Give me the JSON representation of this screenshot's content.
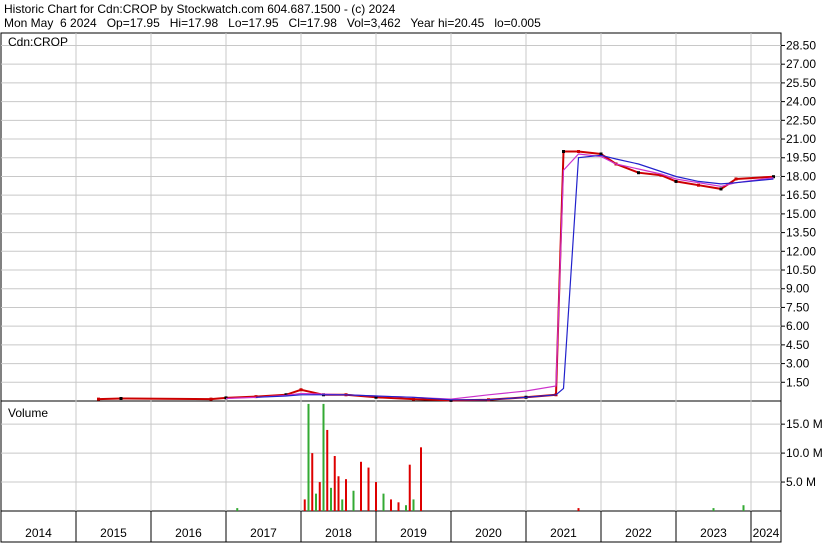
{
  "header": {
    "line1": "Historic Chart for Cdn:CROP by Stockwatch.com 604.687.1500 - (c) 2024",
    "line2": "Mon May  6 2024   Op=17.95   Hi=17.98   Lo=17.95   Cl=17.98   Vol=3,462   Year hi=20.45   lo=0.005"
  },
  "colors": {
    "price_up": "#000000",
    "price_down": "#cc0000",
    "ma_short": "#cc33cc",
    "ma_long": "#2222cc",
    "vol_up": "#33aa33",
    "vol_down": "#dd0000",
    "grid": "#c8c8c8"
  },
  "chart_data": [
    {
      "type": "line",
      "panel": "price",
      "label": "Cdn:CROP",
      "y_ticks": [
        "1.50",
        "3.00",
        "4.50",
        "6.00",
        "7.50",
        "9.00",
        "10.50",
        "12.00",
        "13.50",
        "15.00",
        "16.50",
        "18.00",
        "19.50",
        "21.00",
        "22.50",
        "24.00",
        "25.50",
        "27.00",
        "28.50"
      ],
      "ylim": [
        0,
        29.5
      ],
      "x_labels": [
        "2014",
        "2015",
        "2016",
        "2017",
        "2018",
        "2019",
        "2020",
        "2021",
        "2022",
        "2023",
        "2024"
      ],
      "x": [
        2015.3,
        2015.6,
        2016.8,
        2017.0,
        2017.4,
        2017.8,
        2018.0,
        2018.3,
        2018.6,
        2019.0,
        2019.5,
        2020.0,
        2020.5,
        2021.0,
        2021.4,
        2021.5,
        2021.7,
        2022.0,
        2022.2,
        2022.5,
        2022.8,
        2023.0,
        2023.3,
        2023.6,
        2023.8,
        2024.3
      ],
      "series": [
        {
          "values": [
            0.15,
            0.2,
            0.15,
            0.25,
            0.35,
            0.5,
            0.9,
            0.5,
            0.5,
            0.3,
            0.15,
            0.05,
            0.1,
            0.3,
            0.5,
            20.0,
            20.0,
            19.8,
            19.0,
            18.3,
            18.1,
            17.6,
            17.3,
            17.0,
            17.8,
            17.98
          ]
        },
        {
          "values": [
            null,
            null,
            null,
            0.2,
            0.3,
            0.45,
            0.6,
            0.55,
            0.5,
            0.4,
            0.3,
            0.15,
            0.5,
            0.8,
            1.2,
            18.5,
            19.8,
            19.6,
            19.0,
            18.6,
            18.2,
            17.8,
            17.5,
            17.2,
            17.5,
            17.9
          ]
        },
        {
          "values": [
            null,
            null,
            null,
            null,
            0.3,
            0.4,
            0.5,
            0.5,
            0.5,
            0.4,
            0.3,
            0.1,
            0.1,
            0.3,
            0.5,
            1.0,
            19.5,
            19.7,
            19.4,
            19.0,
            18.4,
            18.0,
            17.6,
            17.4,
            17.5,
            17.8
          ]
        }
      ]
    },
    {
      "type": "bar",
      "panel": "volume",
      "label": "Volume",
      "y_ticks": [
        "5.0 M",
        "10.0 M",
        "15.0 M"
      ],
      "ylim": [
        0,
        19
      ],
      "x": [
        2017.15,
        2018.05,
        2018.1,
        2018.15,
        2018.2,
        2018.25,
        2018.3,
        2018.35,
        2018.4,
        2018.45,
        2018.5,
        2018.55,
        2018.6,
        2018.7,
        2018.8,
        2018.9,
        2019.0,
        2019.1,
        2019.2,
        2019.3,
        2019.4,
        2019.45,
        2019.5,
        2019.6,
        2021.7,
        2023.5,
        2023.9
      ],
      "values": [
        0.5,
        2.0,
        18.5,
        10.0,
        3.0,
        5.0,
        18.5,
        14.0,
        4.0,
        9.5,
        6.0,
        2.0,
        5.5,
        3.5,
        8.5,
        7.5,
        5.0,
        3.0,
        2.0,
        1.5,
        1.0,
        8.0,
        2.0,
        11.0,
        0.5,
        0.5,
        1.0
      ],
      "up": [
        true,
        false,
        true,
        false,
        true,
        false,
        true,
        false,
        true,
        false,
        false,
        true,
        false,
        true,
        false,
        false,
        false,
        true,
        false,
        false,
        true,
        false,
        true,
        false,
        false,
        true,
        true
      ]
    }
  ]
}
